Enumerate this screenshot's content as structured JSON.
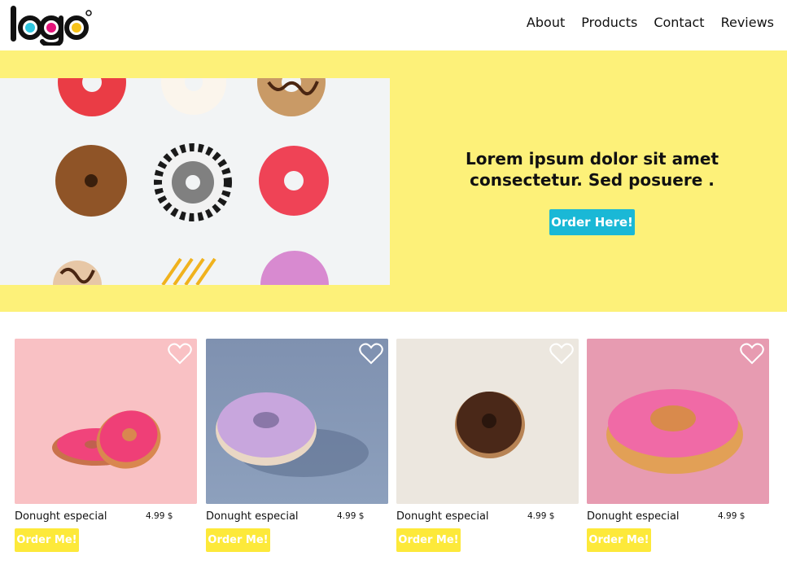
{
  "header": {
    "logo_text": "logo",
    "nav": [
      "About",
      "Products",
      "Contact",
      "Reviews"
    ]
  },
  "hero": {
    "headline": "Lorem ipsum dolor sit amet consectetur. Sed posuere .",
    "button_label": "Order Here!"
  },
  "products": [
    {
      "name": "Donught especial",
      "price": "4.99 $",
      "button_label": "Order Me!",
      "bg": "#f9c1c4"
    },
    {
      "name": "Donught especial",
      "price": "4.99 $",
      "button_label": "Order Me!",
      "bg": "#8397b6"
    },
    {
      "name": "Donught especial",
      "price": "4.99 $",
      "button_label": "Order Me!",
      "bg": "#ece7df"
    },
    {
      "name": "Donught especial",
      "price": "4.99 $",
      "button_label": "Order Me!",
      "bg": "#e79bb1"
    }
  ],
  "colors": {
    "hero_bg": "#fdf179",
    "hero_button": "#1ab8d6",
    "card_button": "#fde93a"
  }
}
